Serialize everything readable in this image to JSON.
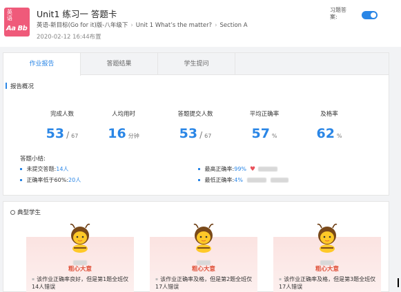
{
  "header": {
    "icon": {
      "cn": "英语",
      "en": "Aa Bb"
    },
    "title": "Unit1 练习一 答题卡",
    "breadcrumb": [
      "英语-新目标(Go for it)版-八年级下",
      "Unit 1 What’s the matter?",
      "Section A"
    ],
    "time": "2020-02-12 16:44布置",
    "toggle_label": "习题答案:",
    "toggle_on": true
  },
  "tabs": [
    "作业报告",
    "答题结果",
    "学生提问"
  ],
  "report": {
    "section_title": "报告概况",
    "stats": [
      {
        "label": "完成人数",
        "value": "53",
        "suffix": "67",
        "type": "fraction"
      },
      {
        "label": "人均用时",
        "value": "16",
        "suffix": "分钟",
        "type": "unit"
      },
      {
        "label": "答题提交人数",
        "value": "53",
        "suffix": "67",
        "type": "fraction"
      },
      {
        "label": "平均正确率",
        "value": "57",
        "suffix": "%",
        "type": "unit"
      },
      {
        "label": "及格率",
        "value": "62",
        "suffix": "%",
        "type": "unit"
      }
    ],
    "summary_title": "答题小结:",
    "summary": {
      "unsubmitted_label": "未提交答题:",
      "unsubmitted_value": "14人",
      "low_rate_label": "正确率低于60%:",
      "low_rate_value": "20人",
      "highest_label": "最高正确率:",
      "highest_value": "99%",
      "lowest_label": "最低正确率:",
      "lowest_value": "4%"
    }
  },
  "typical": {
    "title": "典型学生",
    "students": [
      {
        "tag": "粗心大意",
        "desc": "该作业正确率良好，但是第1题全班仅14人错误"
      },
      {
        "tag": "粗心大意",
        "desc": "该作业正确率及格，但是第2题全班仅17人错误"
      },
      {
        "tag": "粗心大意",
        "desc": "该作业正确率及格，但是第3题全班仅17人错误"
      }
    ]
  },
  "colors": {
    "accent": "#2a86e6",
    "icon_bg": "#ef5a7a",
    "tag": "#e0533c",
    "heart": "#e9505a"
  }
}
